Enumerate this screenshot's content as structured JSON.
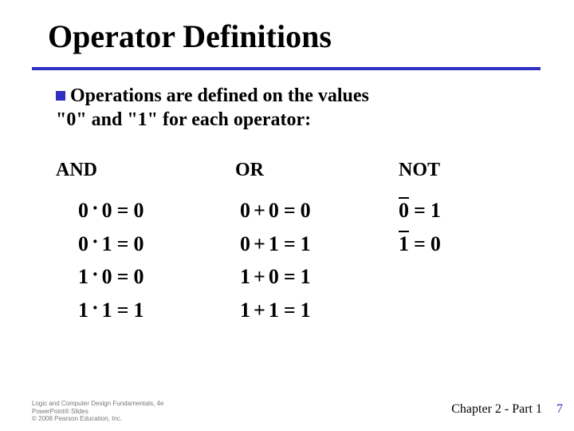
{
  "title": "Operator Definitions",
  "intro_line1": "Operations are defined on the values",
  "intro_line2": "\"0\" and \"1\" for each operator:",
  "columns": {
    "and": {
      "heading": "AND",
      "rows": [
        {
          "a": "0",
          "b": "0",
          "r": "0"
        },
        {
          "a": "0",
          "b": "1",
          "r": "0"
        },
        {
          "a": "1",
          "b": "0",
          "r": "0"
        },
        {
          "a": "1",
          "b": "1",
          "r": "1"
        }
      ]
    },
    "or": {
      "heading": "OR",
      "rows": [
        {
          "a": "0",
          "b": "0",
          "r": "0"
        },
        {
          "a": "0",
          "b": "1",
          "r": "1"
        },
        {
          "a": "1",
          "b": "0",
          "r": "1"
        },
        {
          "a": "1",
          "b": "1",
          "r": "1"
        }
      ]
    },
    "not": {
      "heading": "NOT",
      "rows": [
        {
          "a": "0",
          "r": "1"
        },
        {
          "a": "1",
          "r": "0"
        }
      ]
    }
  },
  "symbols": {
    "dot": "·",
    "plus": "+",
    "equals": "="
  },
  "footer": {
    "credit_line1": "Logic and Computer Design Fundamentals, 4e",
    "credit_line2": "PowerPoint® Slides",
    "credit_line3": "© 2008 Pearson Education, Inc.",
    "chapter": "Chapter 2 - Part 1",
    "page": "7"
  }
}
